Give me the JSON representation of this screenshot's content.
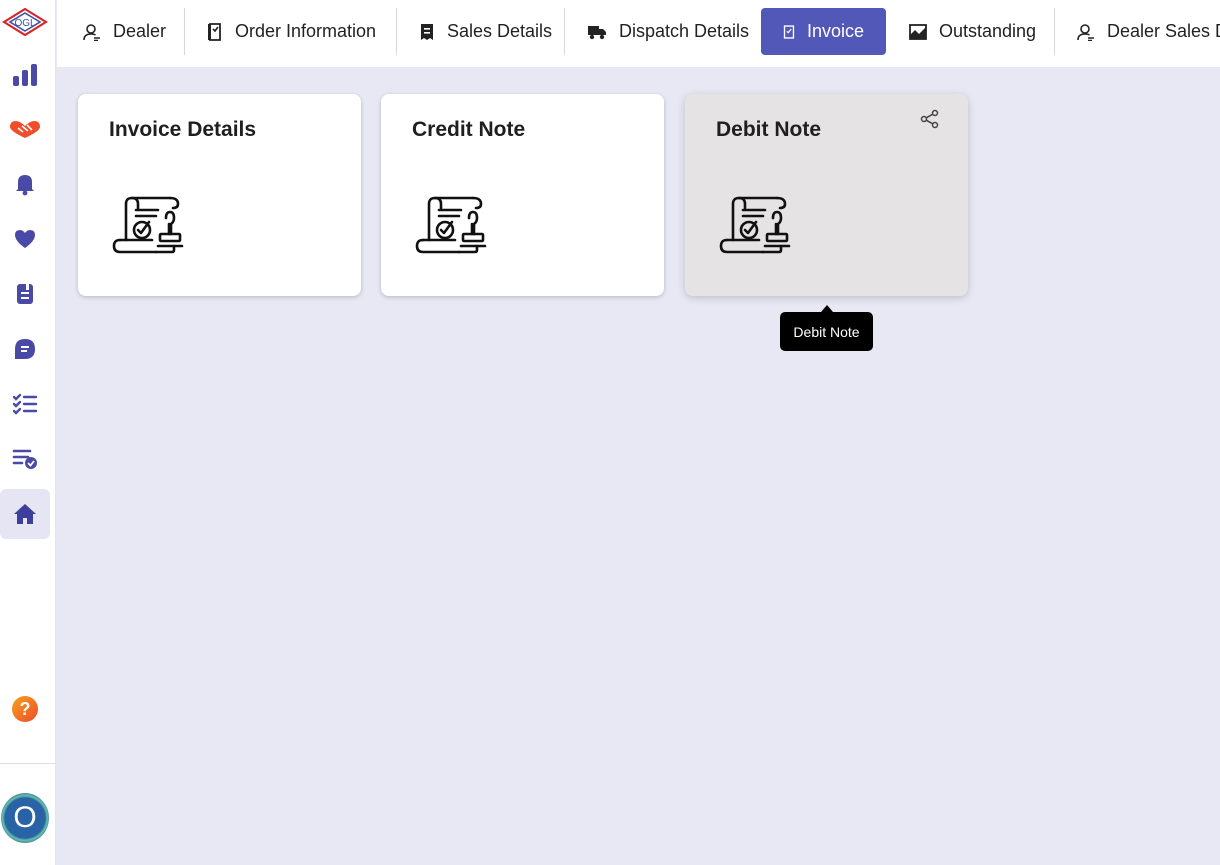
{
  "sidebar": {
    "logo_text": "OGL",
    "items": [
      {
        "name": "analytics",
        "icon": "bar-chart-icon"
      },
      {
        "name": "handshake",
        "icon": "handshake-icon"
      },
      {
        "name": "notifications",
        "icon": "bell-icon"
      },
      {
        "name": "favorites",
        "icon": "heart-icon"
      },
      {
        "name": "documents",
        "icon": "document-icon"
      },
      {
        "name": "messages",
        "icon": "chat-icon"
      },
      {
        "name": "tasks",
        "icon": "checklist-icon"
      },
      {
        "name": "approvals",
        "icon": "list-check-icon"
      },
      {
        "name": "home",
        "icon": "home-icon",
        "active": true
      }
    ],
    "help_icon": "question-icon",
    "avatar_initial": "O"
  },
  "topnav": {
    "tabs": [
      {
        "label": "Dealer",
        "icon": "user-icon"
      },
      {
        "label": "Order Information",
        "icon": "order-icon"
      },
      {
        "label": "Sales Details",
        "icon": "receipt-icon"
      },
      {
        "label": "Dispatch Details",
        "icon": "truck-icon"
      },
      {
        "label": "Invoice",
        "icon": "invoice-icon",
        "active": true
      },
      {
        "label": "Outstanding",
        "icon": "trend-chart-icon"
      },
      {
        "label": "Dealer Sales Details",
        "icon": "user-icon"
      }
    ]
  },
  "cards": [
    {
      "title": "Invoice Details",
      "icon": "certificate-stamp-icon"
    },
    {
      "title": "Credit Note",
      "icon": "certificate-stamp-icon"
    },
    {
      "title": "Debit Note",
      "icon": "certificate-stamp-icon",
      "hovered": true
    }
  ],
  "tooltip": {
    "text": "Debit Note"
  },
  "colors": {
    "accent": "#5258b8",
    "sidebar_icon": "#4a4aa6",
    "background": "#e8e8f4"
  }
}
